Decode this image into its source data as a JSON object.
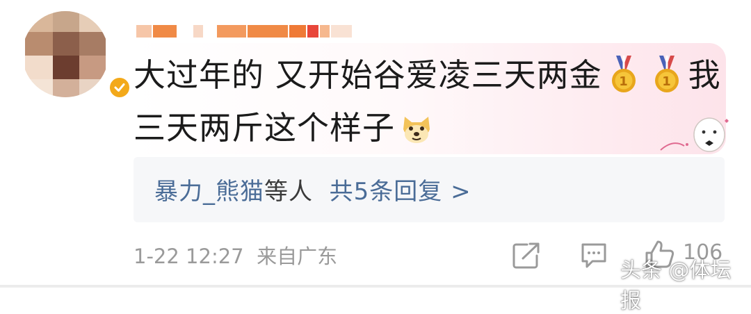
{
  "comment": {
    "text_line1": "大过年的 又开始谷爱凌三天两金",
    "text_line1_tail": "我",
    "text_line2": "三天两斤这个样子",
    "medal_icon": "gold-medal-icon",
    "emoji_icon": "doge-icon"
  },
  "replies": {
    "name": "暴力_熊猫",
    "suffix": "等人",
    "count_text": "共5条回复 >"
  },
  "footer": {
    "date": "1-22",
    "time": "12:27",
    "location": "来自广东",
    "like_count": "106"
  },
  "watermark": "头条 @体坛报",
  "colors": {
    "link": "#4a6c97",
    "meta": "#9a9a9a",
    "verified": "#f3a91a",
    "reply_bg": "#f6f7f9"
  }
}
